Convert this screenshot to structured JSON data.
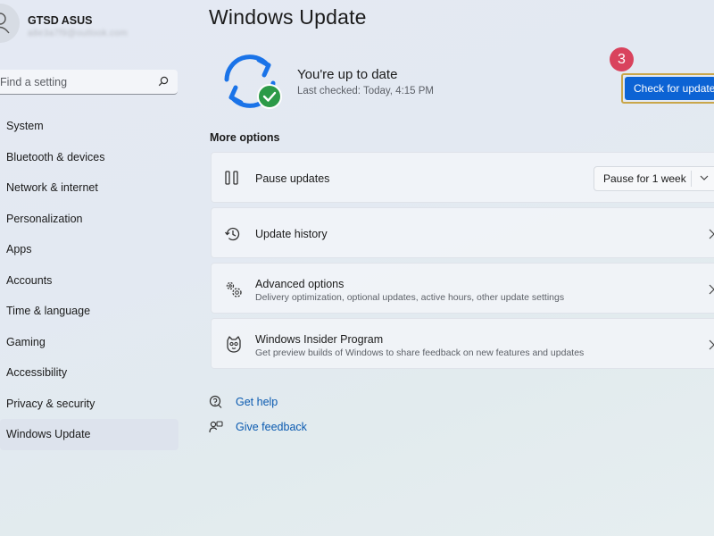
{
  "user": {
    "name": "GTSD ASUS",
    "email": "a8e3a7f9@outlook.com"
  },
  "search": {
    "placeholder": "Find a setting"
  },
  "nav": {
    "items": [
      {
        "label": "System"
      },
      {
        "label": "Bluetooth & devices"
      },
      {
        "label": "Network & internet"
      },
      {
        "label": "Personalization"
      },
      {
        "label": "Apps"
      },
      {
        "label": "Accounts"
      },
      {
        "label": "Time & language"
      },
      {
        "label": "Gaming"
      },
      {
        "label": "Accessibility"
      },
      {
        "label": "Privacy & security"
      },
      {
        "label": "Windows Update"
      }
    ],
    "active": "Windows Update"
  },
  "page": {
    "title": "Windows Update"
  },
  "status": {
    "title": "You're up to date",
    "last_checked": "Last checked: Today, 4:15 PM",
    "icon": "sync-check-icon"
  },
  "step_badge": "3",
  "check_button": "Check for updates",
  "more_options": {
    "label": "More options",
    "pause": {
      "title": "Pause updates",
      "dropdown_value": "Pause for 1 week"
    },
    "history": {
      "title": "Update history"
    },
    "advanced": {
      "title": "Advanced options",
      "subtitle": "Delivery optimization, optional updates, active hours, other update settings"
    },
    "insider": {
      "title": "Windows Insider Program",
      "subtitle": "Get preview builds of Windows to share feedback on new features and updates"
    }
  },
  "links": {
    "help": "Get help",
    "feedback": "Give feedback"
  },
  "colors": {
    "accent": "#0c63d4",
    "badge": "#d9435d",
    "success": "#2c9a48",
    "link": "#0a5ab0"
  }
}
